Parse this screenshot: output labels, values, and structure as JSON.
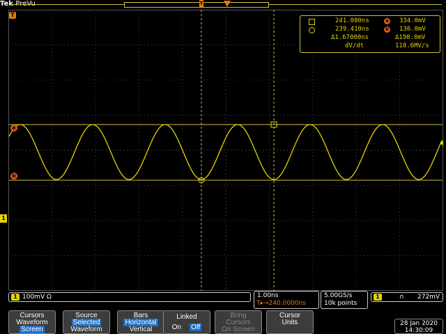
{
  "header": {
    "brand": "Tek",
    "product": "PreVu"
  },
  "markers": {
    "trigger_t": "T",
    "cursor_a": "a",
    "cursor_b": "b",
    "channel1": "1",
    "trig_pos": "T"
  },
  "readout": {
    "row1_time": "241.080ns",
    "row1_value": "334.0mV",
    "row2_time": "239.410ns",
    "row2_value": "136.0mV",
    "delta_time": "Δ1.67000ns",
    "delta_value": "Δ198.0mV",
    "dvdt_label": "dV/dt",
    "dvdt_value": "118.6MV/s",
    "icons": [
      "square-cursor-icon",
      "circle-cursor-icon",
      "cursor-a-icon",
      "cursor-b-icon"
    ]
  },
  "status": {
    "ch1_badge": "1",
    "ch1_scale": "100mV Ω",
    "timebase": "1.00ns",
    "trig_delay": "T▸→240.0000ns",
    "sample_rate": "5.00GS/s",
    "record_length": "10k points",
    "trig_ch": "1",
    "trig_slope": "∩",
    "trig_level": "272mV"
  },
  "softkeys": [
    {
      "l1": "Cursors",
      "l2": "Waveform",
      "l3": "Screen",
      "selected": "l3"
    },
    {
      "l1": "Source",
      "l2": "Selected",
      "l3": "Waveform",
      "selected": "l2"
    },
    {
      "l1": "Bars",
      "l2": "Horizontal",
      "l3": "Vertical",
      "selected": "l2"
    },
    {
      "l1": "Linked",
      "l2": "On",
      "l3": "Off",
      "selected": "l3"
    },
    {
      "l1": "Bring",
      "l2": "Cursors",
      "l3": "On Screen",
      "disabled": true
    },
    {
      "l1": "Cursor",
      "l2": "Units",
      "l3": ""
    }
  ],
  "datetime": {
    "date": "28 Jan 2020",
    "time": "14:30:09"
  },
  "colors": {
    "trace": "#e6d200",
    "cursor": "#d6c23a",
    "accent": "#e07a10",
    "select": "#1e6fc4"
  }
}
